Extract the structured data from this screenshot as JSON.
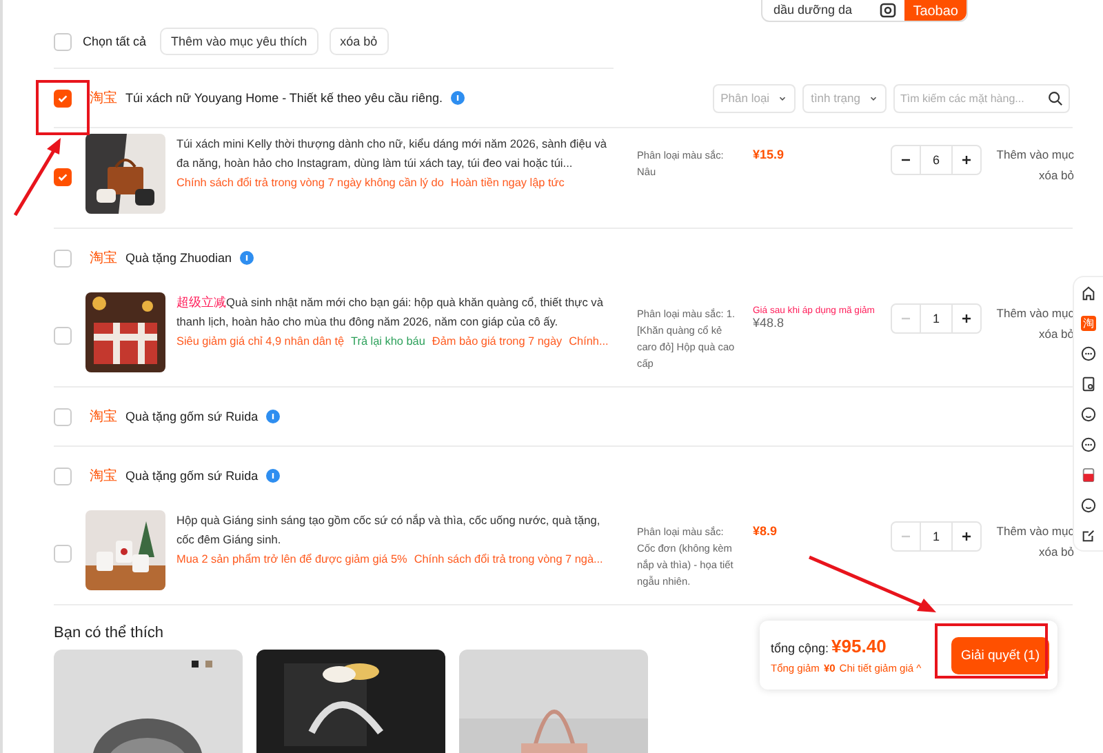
{
  "search": {
    "value": "dầu dưỡng da",
    "button": "Taobao"
  },
  "toolbar": {
    "select_all": {
      "label": "Chọn tất cả",
      "checked": false
    },
    "buttons": [
      "Thêm vào mục yêu thích",
      "xóa bỏ"
    ]
  },
  "filters": {
    "dropdowns": [
      "Phân loại",
      "tình trạng"
    ],
    "search_placeholder": "Tìm kiếm các mặt hàng..."
  },
  "shops": [
    {
      "platform": "淘宝",
      "name": "Túi xách nữ Youyang Home - Thiết kế theo yêu cầu riêng.",
      "checked": true,
      "items": [
        {
          "checked": true,
          "title": "Túi xách mini Kelly thời thượng dành cho nữ, kiểu dáng mới năm 2026, sành điệu và đa năng, hoàn hảo cho Instagram, dùng làm túi xách tay, túi đeo vai hoặc túi...",
          "tags": [
            {
              "text": "Chính sách đổi trả trong vòng 7 ngày không cần lý do",
              "color": "#ff5a1f"
            },
            {
              "text": "Hoàn tiền ngay lập tức",
              "color": "#ff5a1f"
            }
          ],
          "variant": "Phân loại màu sắc: Nâu",
          "price": "¥15.9",
          "price_discounted": false,
          "qty": "6",
          "minus_disabled": false,
          "actions": [
            "Thêm vào mục",
            "xóa bỏ"
          ]
        }
      ]
    },
    {
      "platform": "淘宝",
      "name": "Quà tặng Zhuodian",
      "checked": false,
      "items": [
        {
          "checked": false,
          "prefix": "超级立减",
          "title": "Quà sinh nhật năm mới cho bạn gái: hộp quà khăn quàng cổ, thiết thực và thanh lịch, hoàn hảo cho mùa thu đông năm 2026, năm con giáp của cô ấy.",
          "tags": [
            {
              "text": "Siêu giảm giá chỉ 4,9 nhân dân tệ",
              "color": "#ff5a1f"
            },
            {
              "text": "Trả lại kho báu",
              "color": "#2ca05a"
            },
            {
              "text": "Đảm bảo giá trong 7 ngày",
              "color": "#ff5a1f"
            },
            {
              "text": "Chính...",
              "color": "#ff5a1f"
            }
          ],
          "variant": "Phân loại màu sắc: 1. [Khăn quàng cổ kẻ caro đỏ] Hộp quà cao cấp",
          "price_note": "Giá sau khi áp dụng mã giảm",
          "price": "¥48.8",
          "price_discounted": true,
          "qty": "1",
          "minus_disabled": true,
          "actions": [
            "Thêm vào mục",
            "xóa bỏ"
          ]
        }
      ]
    },
    {
      "platform": "淘宝",
      "name": "Quà tặng gốm sứ Ruida",
      "checked": false
    },
    {
      "platform": "淘宝",
      "name": "Quà tặng gốm sứ Ruida",
      "checked": false,
      "items": [
        {
          "checked": false,
          "title": "Hộp quà Giáng sinh sáng tạo gồm cốc sứ có nắp và thìa, cốc uống nước, quà tặng, cốc đêm Giáng sinh.",
          "tags": [
            {
              "text": "Mua 2 sản phẩm trở lên để được giảm giá 5%",
              "color": "#ff5a1f"
            },
            {
              "text": "Chính sách đổi trả trong vòng 7 ngà...",
              "color": "#ff5a1f"
            }
          ],
          "variant": "Phân loại màu sắc: Cốc đơn (không kèm nắp và thìa) - họa tiết ngẫu nhiên.",
          "price": "¥8.9",
          "price_discounted": false,
          "qty": "1",
          "minus_disabled": true,
          "actions": [
            "Thêm vào mục",
            "xóa bỏ"
          ]
        }
      ]
    }
  ],
  "recommend": {
    "title": "Bạn có thể thích"
  },
  "checkout": {
    "total_label": "tổng cộng:",
    "total": "¥95.40",
    "discount_label": "Tổng giảm",
    "discount": "¥0",
    "details": "Chi tiết giảm giá ^",
    "button": "Giải quyết (1)"
  },
  "sidebar": {
    "logo": "淘"
  }
}
